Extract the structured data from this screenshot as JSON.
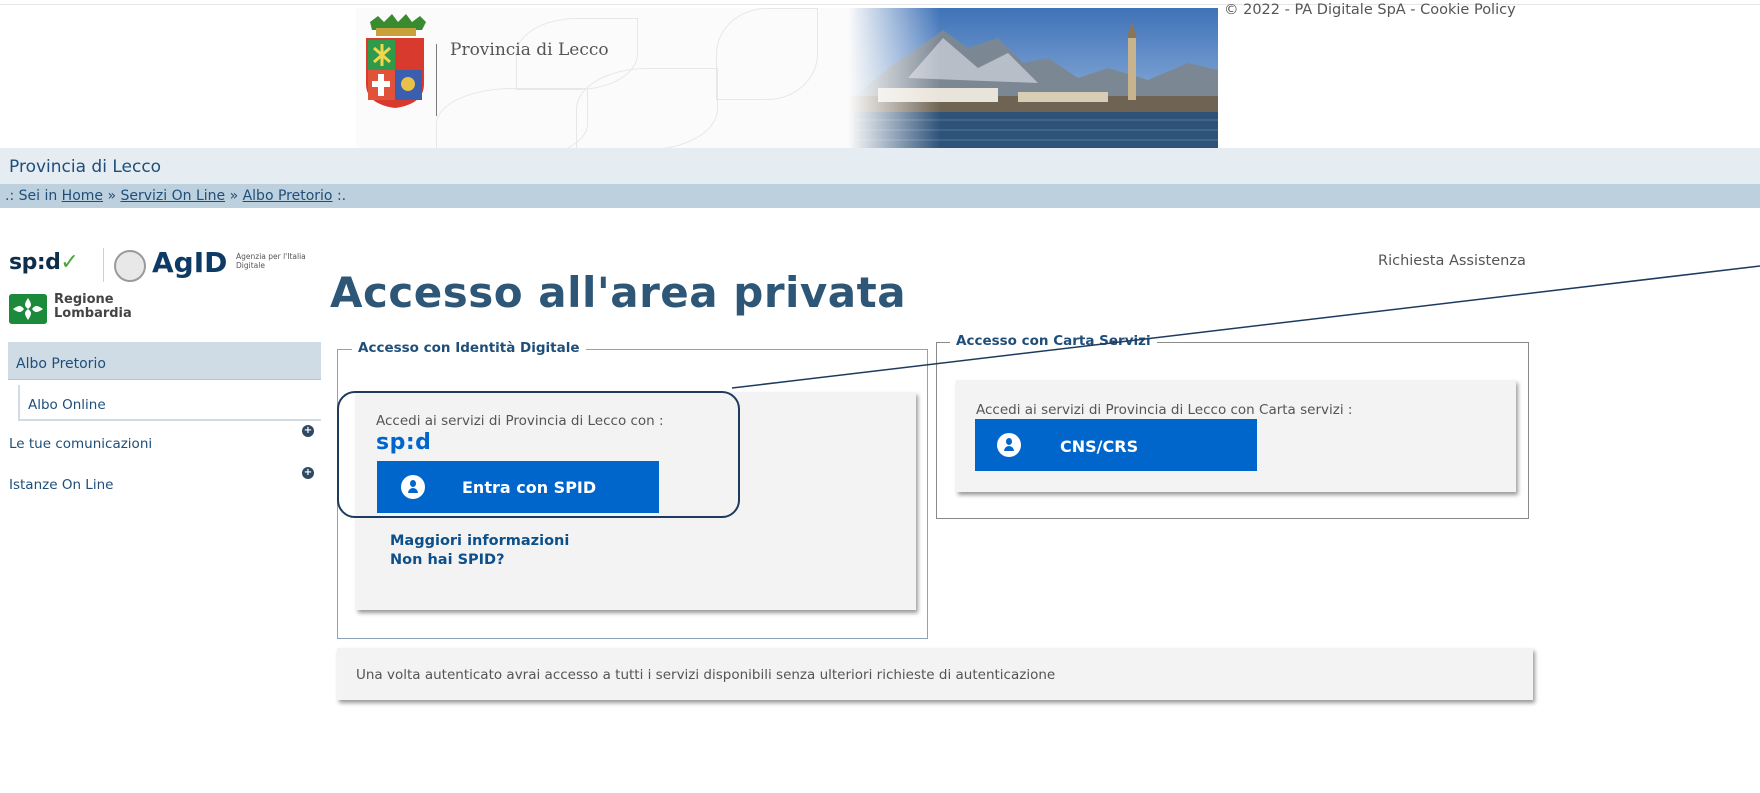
{
  "header": {
    "org_logo_text": "Provincia di Lecco",
    "copyright": "© 2022 - PA Digitale SpA - Cookie Policy"
  },
  "org_bar": {
    "name": "Provincia di Lecco"
  },
  "breadcrumb": {
    "prefix": ".: Sei in ",
    "items": [
      "Home",
      "Servizi On Line",
      "Albo Pretorio"
    ],
    "separator": " » ",
    "suffix": " :."
  },
  "logos": {
    "spid": "sp:d",
    "agid": "AgID",
    "agid_sub": "Agenzia per l'Italia Digitale",
    "lombardia_line1": "Regione",
    "lombardia_line2": "Lombardia"
  },
  "assistance_link": "Richiesta Assistenza",
  "sidebar": {
    "items": [
      {
        "label": "Albo Pretorio"
      },
      {
        "label": "Albo Online"
      },
      {
        "label": "Le tue comunicazioni"
      },
      {
        "label": "Istanze On Line"
      }
    ]
  },
  "main": {
    "title": "Accesso all'area privata",
    "digital_identity": {
      "legend": "Accesso con Identità Digitale",
      "intro": "Accedi ai servizi di Provincia di Lecco con :",
      "spid_mark": "sp:d",
      "button_label": "Entra con SPID",
      "more_info": "Maggiori informazioni",
      "no_spid": "Non hai SPID?"
    },
    "service_card": {
      "legend": "Accesso con Carta Servizi",
      "intro": "Accedi ai servizi di Provincia di Lecco con Carta servizi :",
      "button_label": "CNS/CRS"
    },
    "note": "Una volta autenticato avrai accesso a tutti i servizi disponibili senza ulteriori richieste di autenticazione"
  },
  "colors": {
    "primary_button": "#0066cc",
    "title": "#2e5676",
    "link": "#1f4e79",
    "annotation": "#1f3a5f"
  },
  "icons": [
    "user-circle-icon",
    "plus-circle-icon",
    "agid-emblem-icon",
    "lombardia-logo-icon",
    "crest-icon"
  ]
}
